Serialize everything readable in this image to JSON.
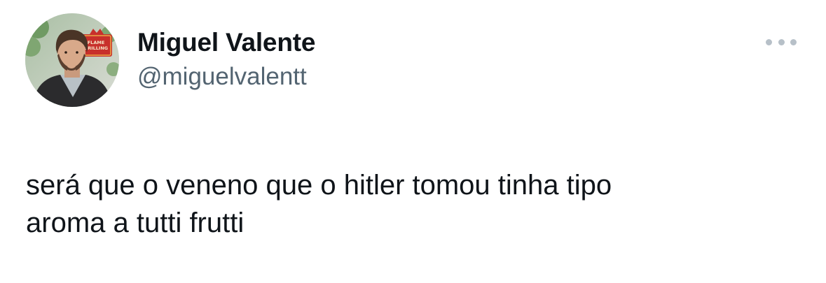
{
  "author": {
    "display_name": "Miguel Valente",
    "handle": "@miguelvalentt",
    "avatar": {
      "sign_lines": [
        "FLAME",
        "GRILLING"
      ]
    }
  },
  "tweet": {
    "text": "será que o veneno que o hitler tomou tinha tipo\naroma a tutti frutti"
  },
  "menu": {
    "icon": "more-horizontal-icon"
  },
  "colors": {
    "text_primary": "#0f1419",
    "text_secondary": "#536471",
    "menu_dots": "#b7c0c8",
    "background": "#ffffff"
  }
}
